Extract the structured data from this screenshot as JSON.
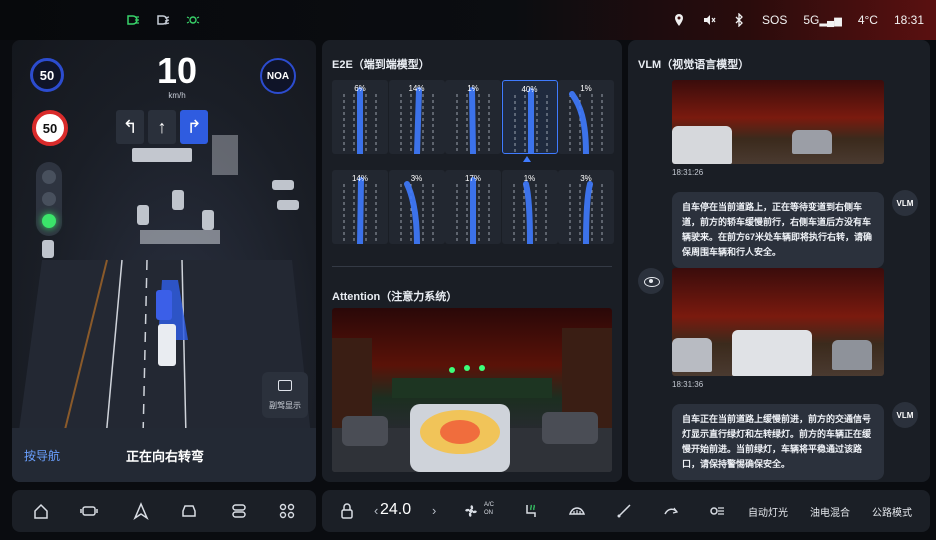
{
  "status_bar": {
    "left_icons": [
      {
        "icon": "headlight-icon",
        "color": "#38d36a"
      },
      {
        "icon": "high-beam-icon",
        "color": "#c6ccd6"
      },
      {
        "icon": "parking-light-icon",
        "color": "#38d36a"
      }
    ],
    "sos": "SOS",
    "signal": "5G",
    "temperature": "4°C",
    "time": "18:31"
  },
  "nav": {
    "speed_limit_left": "50",
    "speed": "10",
    "speed_unit": "km/h",
    "noa_badge": "NOA",
    "road_sign_limit": "50",
    "lane_arrows": [
      "↰",
      "↑",
      "↱"
    ],
    "hud_label": "副驾显示",
    "nav_button": "按导航",
    "nav_status": "正在向右转弯"
  },
  "e2e": {
    "title": "E2E（端到端模型）",
    "trajectories": [
      {
        "percent": "6%",
        "selected": false
      },
      {
        "percent": "14%",
        "selected": false
      },
      {
        "percent": "1%",
        "selected": false
      },
      {
        "percent": "40%",
        "selected": true
      },
      {
        "percent": "1%",
        "selected": false
      },
      {
        "percent": "14%",
        "selected": false
      },
      {
        "percent": "3%",
        "selected": false
      },
      {
        "percent": "17%",
        "selected": false
      },
      {
        "percent": "1%",
        "selected": false
      },
      {
        "percent": "3%",
        "selected": false
      }
    ],
    "attention_title": "Attention（注意力系统）"
  },
  "vlm": {
    "title": "VLM（视觉语言模型）",
    "tag": "VLM",
    "messages": [
      {
        "time": "18:31:26",
        "text": "自车停在当前道路上，正在等待变道到右侧车道，前方的轿车缓慢前行，右侧车道后方没有车辆驶来。在前方67米处车辆即将执行右转，请确保周围车辆和行人安全。"
      },
      {
        "time": "18:31:36",
        "text": "自车正在当前道路上缓慢前进，前方的交通信号灯显示直行绿灯和左转绿灯。前方的车辆正在缓慢开始前进。当前绿灯，车辆将平稳通过该路口，请保持警惕确保安全。"
      }
    ]
  },
  "dock": {
    "temperature": "24.0",
    "ac_label_top": "A/C",
    "ac_label_bottom": "ON",
    "auto_light": "自动灯光",
    "hybrid": "油电混合",
    "road_mode": "公路模式"
  }
}
